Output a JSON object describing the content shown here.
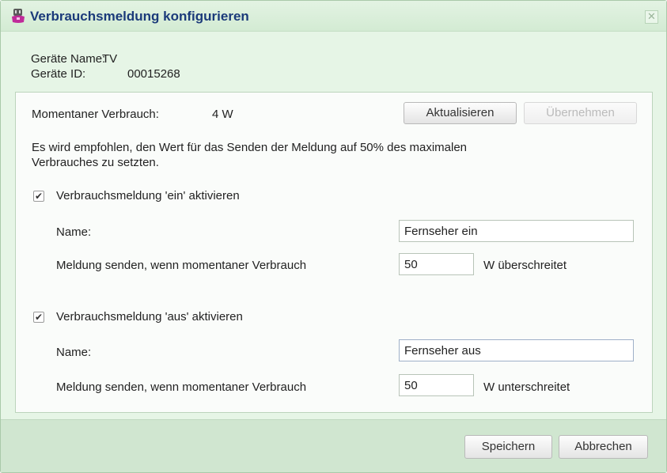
{
  "window": {
    "title": "Verbrauchsmeldung konfigurieren",
    "close_glyph": "✕"
  },
  "device": {
    "name_label": "Geräte Name:",
    "name_value": "TV",
    "id_label": "Geräte ID:",
    "id_value": "00015268"
  },
  "consumption": {
    "label": "Momentaner Verbrauch:",
    "value": "4 W",
    "refresh_button": "Aktualisieren",
    "apply_button": "Übernehmen"
  },
  "hint": {
    "line1": "Es wird empfohlen, den Wert für das Senden der Meldung auf 50% des maximalen",
    "line2": "Verbrauches zu setzten."
  },
  "on_section": {
    "checked": true,
    "checkbox_label": "Verbrauchsmeldung 'ein' aktivieren",
    "name_label": "Name:",
    "name_value": "Fernseher ein",
    "threshold_label": "Meldung senden, wenn momentaner Verbrauch",
    "threshold_value": "50",
    "threshold_suffix": "W überschreitet"
  },
  "off_section": {
    "checked": true,
    "checkbox_label": "Verbrauchsmeldung 'aus' aktivieren",
    "name_label": "Name:",
    "name_value": "Fernseher aus",
    "threshold_label": "Meldung senden, wenn momentaner Verbrauch",
    "threshold_value": "50",
    "threshold_suffix": "W unterschreitet"
  },
  "footer": {
    "save_button": "Speichern",
    "cancel_button": "Abbrechen"
  },
  "icons": {
    "title_icon": "plug-device-icon",
    "check_glyph": "✔"
  }
}
